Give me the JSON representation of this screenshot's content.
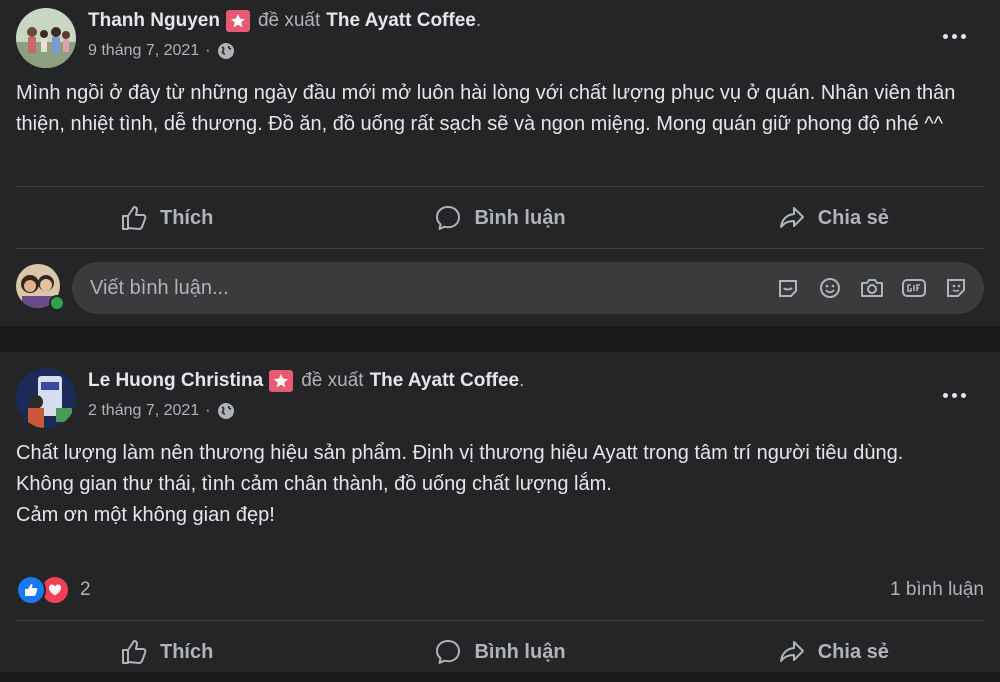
{
  "posts": [
    {
      "author": "Thanh Nguyen",
      "verb": "đề xuất",
      "page": "The Ayatt Coffee",
      "date": "9 tháng 7, 2021",
      "lines": [
        "Mình ngồi ở đây từ những ngày đầu mới mở luôn hài lòng với chất lượng phục vụ ở quán. Nhân viên thân thiện, nhiệt tình, dễ thương. Đồ ăn, đồ uống rất sạch sẽ và ngon miệng. Mong quán giữ phong độ nhé ^^"
      ],
      "actions": {
        "like": "Thích",
        "comment": "Bình luận",
        "share": "Chia sẻ"
      },
      "comment_placeholder": "Viết bình luận..."
    },
    {
      "author": "Le Huong Christina",
      "verb": "đề xuất",
      "page": "The Ayatt Coffee",
      "date": "2 tháng 7, 2021",
      "lines": [
        "Chất lượng làm nên thương hiệu sản phẩm. Định vị thương hiệu Ayatt trong tâm trí người tiêu dùng.",
        "Không gian thư thái, tình cảm chân thành, đồ uống chất lượng lắm.",
        "Cảm ơn một không gian đẹp!"
      ],
      "reaction_count": "2",
      "comment_count": "1 bình luận",
      "actions": {
        "like": "Thích",
        "comment": "Bình luận",
        "share": "Chia sẻ"
      }
    }
  ],
  "colors": {
    "background": "#18191a",
    "card": "#242526",
    "text": "#e4e6eb",
    "secondary_text": "#b0b3b8",
    "recommend_badge": "#e85a74",
    "like_blue": "#1877f2",
    "love_red": "#f33e58",
    "online_green": "#31a24c"
  },
  "icons": [
    "recommend-star-icon",
    "globe-icon",
    "more-options-icon",
    "like-icon",
    "comment-icon",
    "share-icon",
    "sticker-icon",
    "emoji-icon",
    "camera-icon",
    "gif-icon",
    "avatar-sticker-icon",
    "like-reaction-icon",
    "love-reaction-icon"
  ]
}
